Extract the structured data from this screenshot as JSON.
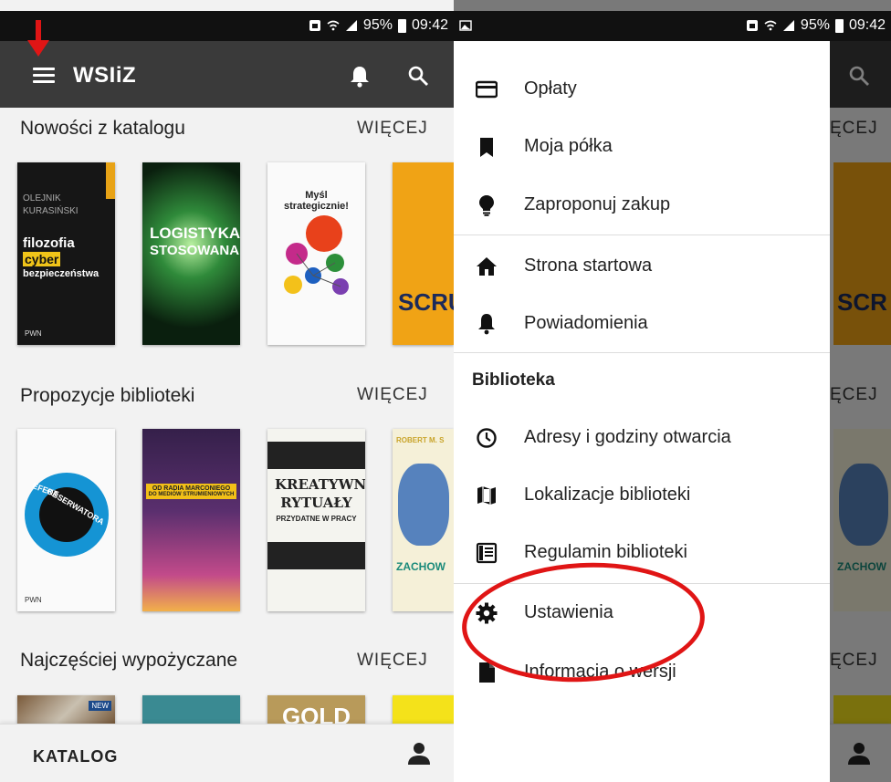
{
  "status": {
    "battery": "95%",
    "time": "09:42"
  },
  "app": {
    "title": "WSIiZ"
  },
  "sections": [
    {
      "title": "Nowości z katalogu",
      "more": "WIĘCEJ",
      "books": [
        {
          "line1": "OLEJNIK",
          "line2": "KURASIŃSKI",
          "line3": "filozofia",
          "line4": "cyber",
          "line5": "bezpieczeństwa",
          "publisher": "PWN"
        },
        {
          "line1": "LOGISTYKA",
          "line2": "STOSOWANA"
        },
        {
          "line1": "Myśl strategicznie!"
        },
        {
          "line1": "SCRU"
        }
      ]
    },
    {
      "title": "Propozycje biblioteki",
      "more": "WIĘCEJ",
      "books": [
        {
          "line1": "EFEKT",
          "line2": "OBSERWATORA",
          "publisher": "PWN"
        },
        {
          "line1": "OD RADIA MARCONIEGO",
          "line2": "DO MEDIÓW STRUMIENIOWYCH"
        },
        {
          "line1": "KREATYWNE",
          "line2": "RYTUAŁY",
          "line3": "PRZYDATNE W PRACY"
        },
        {
          "line1": "ROBERT M. S",
          "line2": "ZACHOW"
        }
      ]
    },
    {
      "title": "Najczęściej wypożyczane",
      "more": "WIĘCEJ",
      "books": [
        {
          "line1": "NEW"
        },
        {
          "line1": ""
        },
        {
          "line1": "GOLD"
        },
        {
          "line1": ""
        }
      ]
    }
  ],
  "bottom_nav": {
    "label": "KATALOG"
  },
  "right_bg": {
    "more": "ĘCEJ",
    "book1": "SCR",
    "book2": "ZACHOW"
  },
  "drawer": {
    "items_top": [
      {
        "label": "Opłaty",
        "icon": "credit-card-icon"
      },
      {
        "label": "Moja półka",
        "icon": "bookmark-icon"
      },
      {
        "label": "Zaproponuj zakup",
        "icon": "lightbulb-icon"
      }
    ],
    "items_mid": [
      {
        "label": "Strona startowa",
        "icon": "home-icon"
      },
      {
        "label": "Powiadomienia",
        "icon": "bell-icon"
      }
    ],
    "library_header": "Biblioteka",
    "items_lib": [
      {
        "label": "Adresy i godziny otwarcia",
        "icon": "clock-icon"
      },
      {
        "label": "Lokalizacje biblioteki",
        "icon": "map-icon"
      },
      {
        "label": "Regulamin biblioteki",
        "icon": "rules-book-icon"
      }
    ],
    "items_bottom": [
      {
        "label": "Ustawienia",
        "icon": "gear-icon"
      },
      {
        "label": "Informacja o wersji",
        "icon": "file-icon"
      }
    ]
  },
  "colors": {
    "appbar": "#3a3a3a",
    "statusbar": "#111111",
    "highlight": "#e01515",
    "background": "#f2f2f2"
  }
}
